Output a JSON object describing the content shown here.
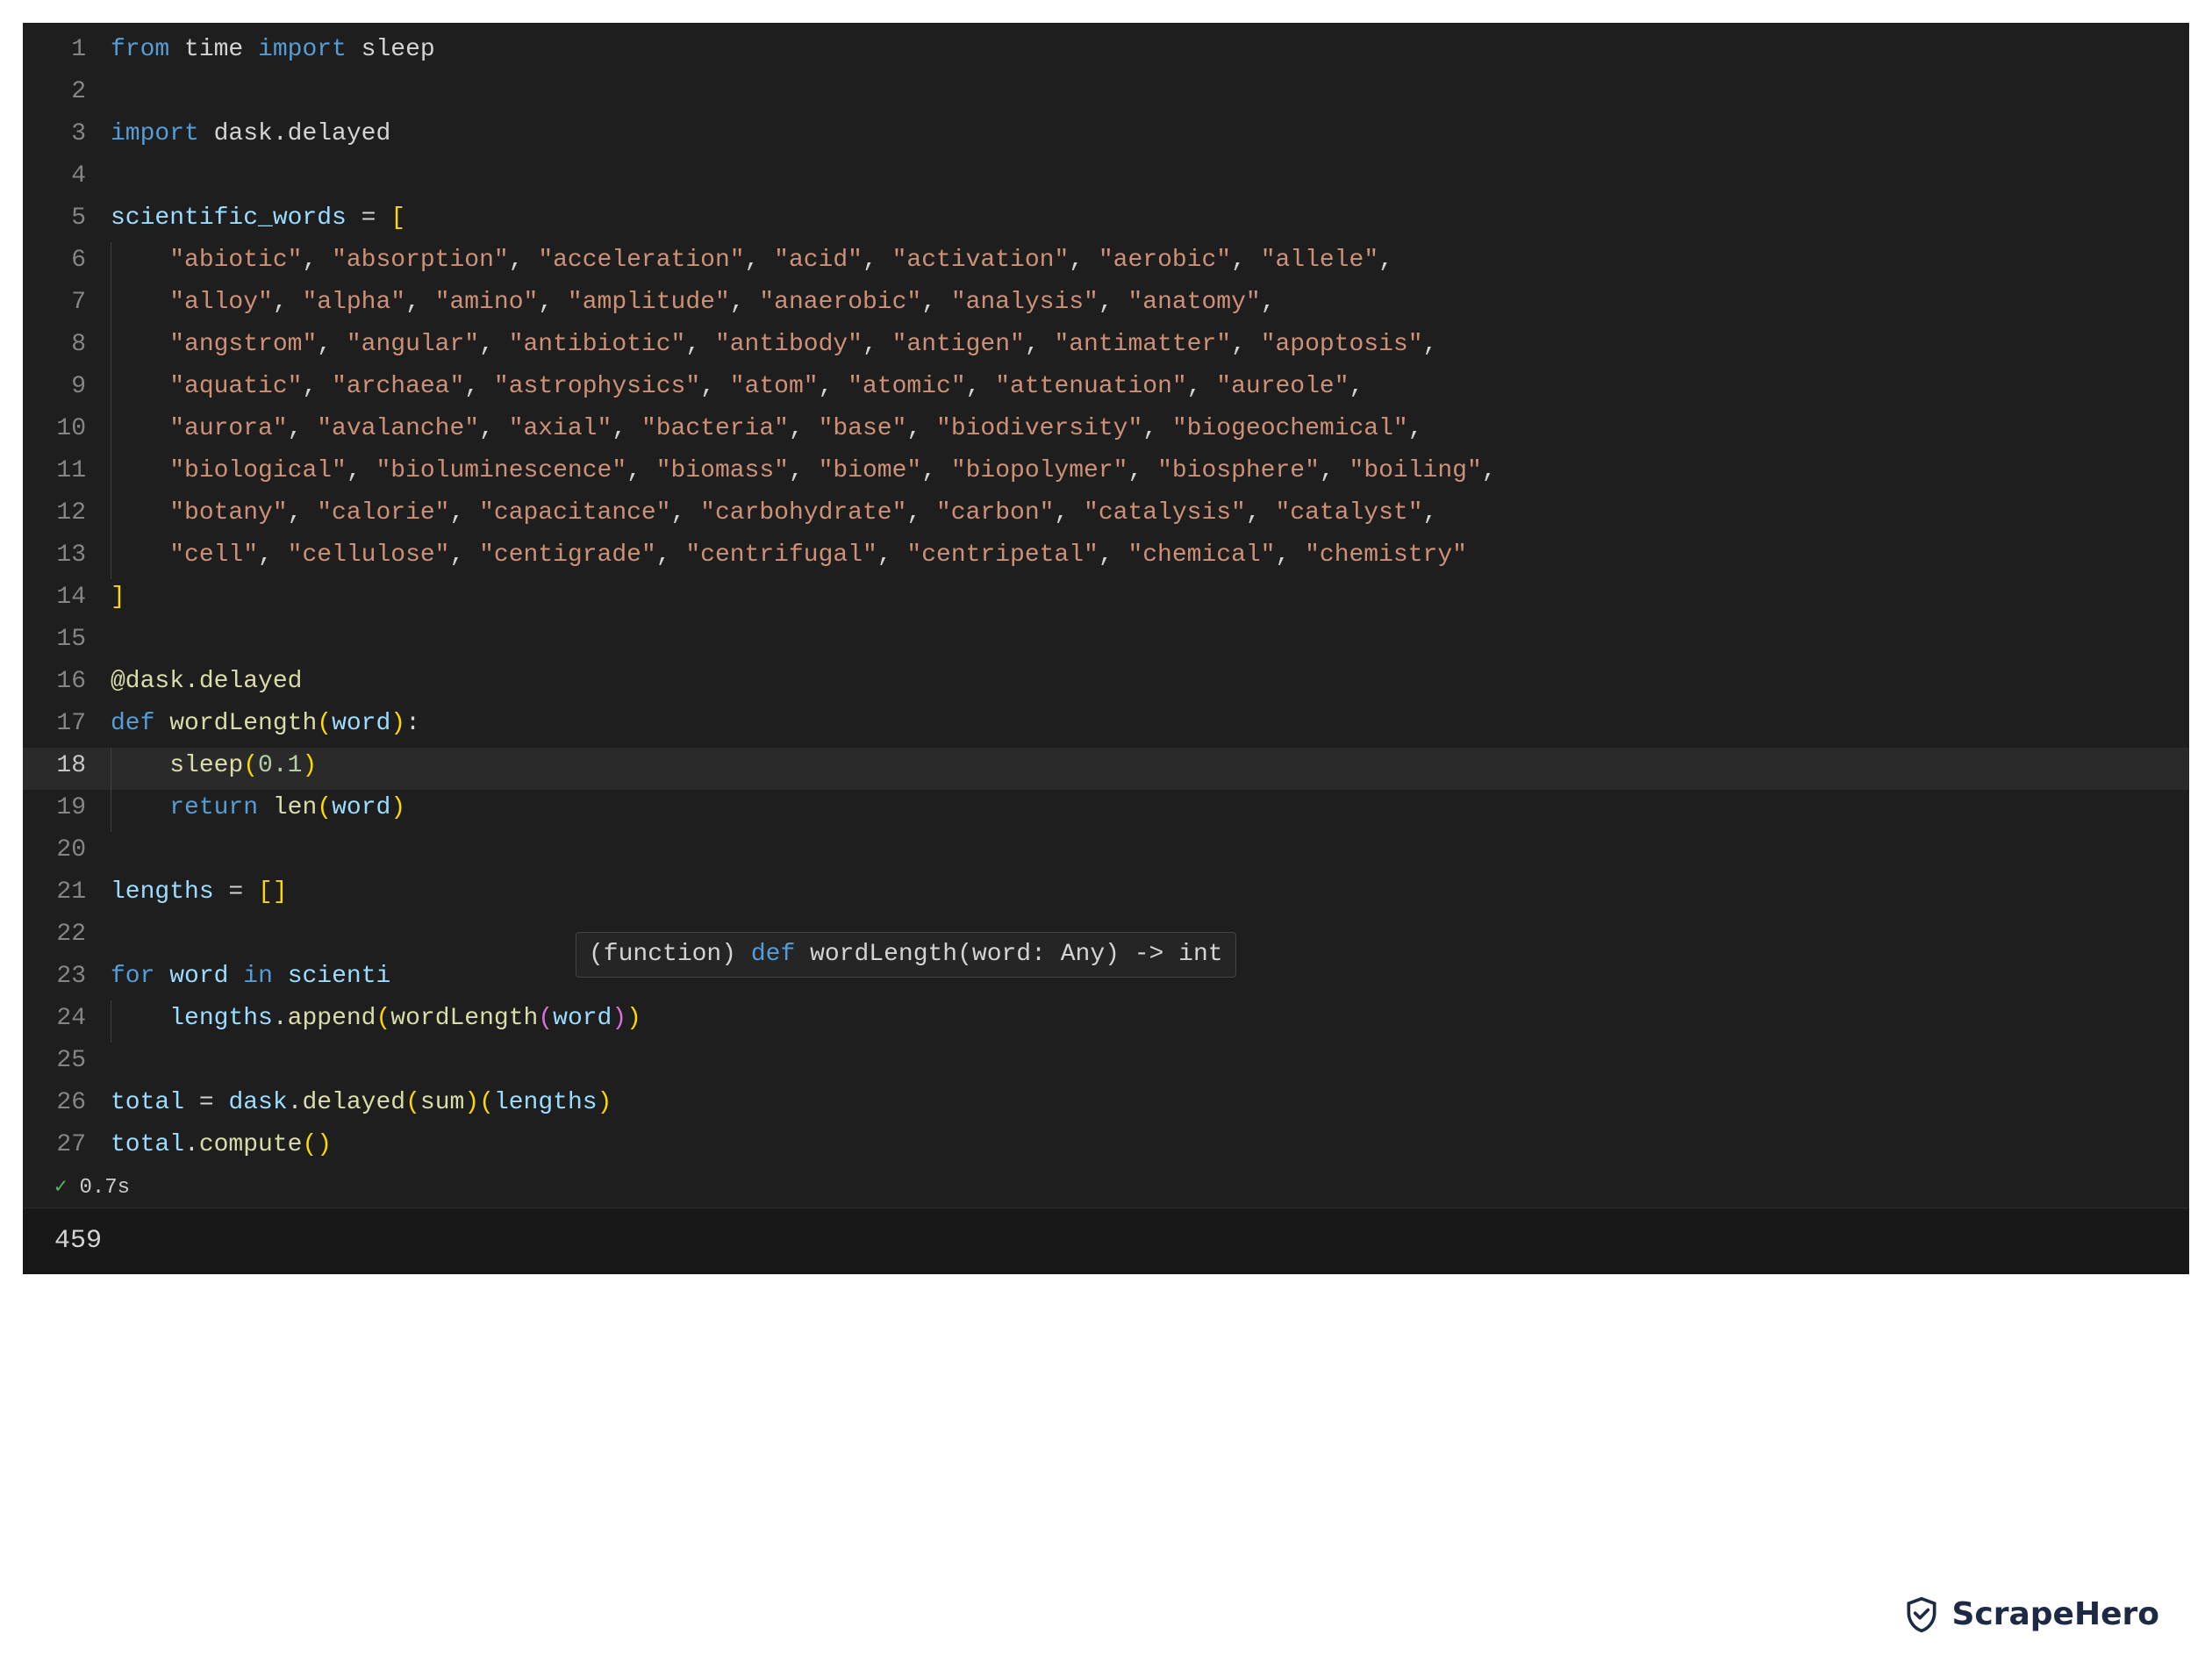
{
  "exec": {
    "status_icon": "✓",
    "duration": "0.7s"
  },
  "output": {
    "value": "459"
  },
  "watermark": {
    "text": "ScrapeHero"
  },
  "hover": {
    "prefix": "(function) ",
    "kw": "def",
    "sig": " wordLength(word: Any) -> int"
  },
  "code": {
    "active_line": 18,
    "lines": [
      {
        "n": 1,
        "guide": false,
        "tokens": [
          {
            "c": "tok-kw",
            "t": "from"
          },
          {
            "c": "tok-default",
            "t": " time "
          },
          {
            "c": "tok-kw",
            "t": "import"
          },
          {
            "c": "tok-default",
            "t": " sleep"
          }
        ]
      },
      {
        "n": 2,
        "guide": false,
        "tokens": []
      },
      {
        "n": 3,
        "guide": false,
        "tokens": [
          {
            "c": "tok-kw",
            "t": "import"
          },
          {
            "c": "tok-default",
            "t": " dask.delayed"
          }
        ]
      },
      {
        "n": 4,
        "guide": false,
        "tokens": []
      },
      {
        "n": 5,
        "guide": false,
        "tokens": [
          {
            "c": "tok-var",
            "t": "scientific_words"
          },
          {
            "c": "tok-default",
            "t": " = "
          },
          {
            "c": "tok-brkt",
            "t": "["
          }
        ]
      },
      {
        "n": 6,
        "guide": true,
        "tokens": [
          {
            "c": "tok-default",
            "t": "    "
          },
          {
            "c": "tok-str",
            "t": "\"abiotic\""
          },
          {
            "c": "tok-default",
            "t": ", "
          },
          {
            "c": "tok-str",
            "t": "\"absorption\""
          },
          {
            "c": "tok-default",
            "t": ", "
          },
          {
            "c": "tok-str",
            "t": "\"acceleration\""
          },
          {
            "c": "tok-default",
            "t": ", "
          },
          {
            "c": "tok-str",
            "t": "\"acid\""
          },
          {
            "c": "tok-default",
            "t": ", "
          },
          {
            "c": "tok-str",
            "t": "\"activation\""
          },
          {
            "c": "tok-default",
            "t": ", "
          },
          {
            "c": "tok-str",
            "t": "\"aerobic\""
          },
          {
            "c": "tok-default",
            "t": ", "
          },
          {
            "c": "tok-str",
            "t": "\"allele\""
          },
          {
            "c": "tok-default",
            "t": ","
          }
        ]
      },
      {
        "n": 7,
        "guide": true,
        "tokens": [
          {
            "c": "tok-default",
            "t": "    "
          },
          {
            "c": "tok-str",
            "t": "\"alloy\""
          },
          {
            "c": "tok-default",
            "t": ", "
          },
          {
            "c": "tok-str",
            "t": "\"alpha\""
          },
          {
            "c": "tok-default",
            "t": ", "
          },
          {
            "c": "tok-str",
            "t": "\"amino\""
          },
          {
            "c": "tok-default",
            "t": ", "
          },
          {
            "c": "tok-str",
            "t": "\"amplitude\""
          },
          {
            "c": "tok-default",
            "t": ", "
          },
          {
            "c": "tok-str",
            "t": "\"anaerobic\""
          },
          {
            "c": "tok-default",
            "t": ", "
          },
          {
            "c": "tok-str",
            "t": "\"analysis\""
          },
          {
            "c": "tok-default",
            "t": ", "
          },
          {
            "c": "tok-str",
            "t": "\"anatomy\""
          },
          {
            "c": "tok-default",
            "t": ","
          }
        ]
      },
      {
        "n": 8,
        "guide": true,
        "tokens": [
          {
            "c": "tok-default",
            "t": "    "
          },
          {
            "c": "tok-str",
            "t": "\"angstrom\""
          },
          {
            "c": "tok-default",
            "t": ", "
          },
          {
            "c": "tok-str",
            "t": "\"angular\""
          },
          {
            "c": "tok-default",
            "t": ", "
          },
          {
            "c": "tok-str",
            "t": "\"antibiotic\""
          },
          {
            "c": "tok-default",
            "t": ", "
          },
          {
            "c": "tok-str",
            "t": "\"antibody\""
          },
          {
            "c": "tok-default",
            "t": ", "
          },
          {
            "c": "tok-str",
            "t": "\"antigen\""
          },
          {
            "c": "tok-default",
            "t": ", "
          },
          {
            "c": "tok-str",
            "t": "\"antimatter\""
          },
          {
            "c": "tok-default",
            "t": ", "
          },
          {
            "c": "tok-str",
            "t": "\"apoptosis\""
          },
          {
            "c": "tok-default",
            "t": ","
          }
        ]
      },
      {
        "n": 9,
        "guide": true,
        "tokens": [
          {
            "c": "tok-default",
            "t": "    "
          },
          {
            "c": "tok-str",
            "t": "\"aquatic\""
          },
          {
            "c": "tok-default",
            "t": ", "
          },
          {
            "c": "tok-str",
            "t": "\"archaea\""
          },
          {
            "c": "tok-default",
            "t": ", "
          },
          {
            "c": "tok-str",
            "t": "\"astrophysics\""
          },
          {
            "c": "tok-default",
            "t": ", "
          },
          {
            "c": "tok-str",
            "t": "\"atom\""
          },
          {
            "c": "tok-default",
            "t": ", "
          },
          {
            "c": "tok-str",
            "t": "\"atomic\""
          },
          {
            "c": "tok-default",
            "t": ", "
          },
          {
            "c": "tok-str",
            "t": "\"attenuation\""
          },
          {
            "c": "tok-default",
            "t": ", "
          },
          {
            "c": "tok-str",
            "t": "\"aureole\""
          },
          {
            "c": "tok-default",
            "t": ","
          }
        ]
      },
      {
        "n": 10,
        "guide": true,
        "tokens": [
          {
            "c": "tok-default",
            "t": "    "
          },
          {
            "c": "tok-str",
            "t": "\"aurora\""
          },
          {
            "c": "tok-default",
            "t": ", "
          },
          {
            "c": "tok-str",
            "t": "\"avalanche\""
          },
          {
            "c": "tok-default",
            "t": ", "
          },
          {
            "c": "tok-str",
            "t": "\"axial\""
          },
          {
            "c": "tok-default",
            "t": ", "
          },
          {
            "c": "tok-str",
            "t": "\"bacteria\""
          },
          {
            "c": "tok-default",
            "t": ", "
          },
          {
            "c": "tok-str",
            "t": "\"base\""
          },
          {
            "c": "tok-default",
            "t": ", "
          },
          {
            "c": "tok-str",
            "t": "\"biodiversity\""
          },
          {
            "c": "tok-default",
            "t": ", "
          },
          {
            "c": "tok-str",
            "t": "\"biogeochemical\""
          },
          {
            "c": "tok-default",
            "t": ","
          }
        ]
      },
      {
        "n": 11,
        "guide": true,
        "tokens": [
          {
            "c": "tok-default",
            "t": "    "
          },
          {
            "c": "tok-str",
            "t": "\"biological\""
          },
          {
            "c": "tok-default",
            "t": ", "
          },
          {
            "c": "tok-str",
            "t": "\"bioluminescence\""
          },
          {
            "c": "tok-default",
            "t": ", "
          },
          {
            "c": "tok-str",
            "t": "\"biomass\""
          },
          {
            "c": "tok-default",
            "t": ", "
          },
          {
            "c": "tok-str",
            "t": "\"biome\""
          },
          {
            "c": "tok-default",
            "t": ", "
          },
          {
            "c": "tok-str",
            "t": "\"biopolymer\""
          },
          {
            "c": "tok-default",
            "t": ", "
          },
          {
            "c": "tok-str",
            "t": "\"biosphere\""
          },
          {
            "c": "tok-default",
            "t": ", "
          },
          {
            "c": "tok-str",
            "t": "\"boiling\""
          },
          {
            "c": "tok-default",
            "t": ","
          }
        ]
      },
      {
        "n": 12,
        "guide": true,
        "tokens": [
          {
            "c": "tok-default",
            "t": "    "
          },
          {
            "c": "tok-str",
            "t": "\"botany\""
          },
          {
            "c": "tok-default",
            "t": ", "
          },
          {
            "c": "tok-str",
            "t": "\"calorie\""
          },
          {
            "c": "tok-default",
            "t": ", "
          },
          {
            "c": "tok-str",
            "t": "\"capacitance\""
          },
          {
            "c": "tok-default",
            "t": ", "
          },
          {
            "c": "tok-str",
            "t": "\"carbohydrate\""
          },
          {
            "c": "tok-default",
            "t": ", "
          },
          {
            "c": "tok-str",
            "t": "\"carbon\""
          },
          {
            "c": "tok-default",
            "t": ", "
          },
          {
            "c": "tok-str",
            "t": "\"catalysis\""
          },
          {
            "c": "tok-default",
            "t": ", "
          },
          {
            "c": "tok-str",
            "t": "\"catalyst\""
          },
          {
            "c": "tok-default",
            "t": ","
          }
        ]
      },
      {
        "n": 13,
        "guide": true,
        "tokens": [
          {
            "c": "tok-default",
            "t": "    "
          },
          {
            "c": "tok-str",
            "t": "\"cell\""
          },
          {
            "c": "tok-default",
            "t": ", "
          },
          {
            "c": "tok-str",
            "t": "\"cellulose\""
          },
          {
            "c": "tok-default",
            "t": ", "
          },
          {
            "c": "tok-str",
            "t": "\"centigrade\""
          },
          {
            "c": "tok-default",
            "t": ", "
          },
          {
            "c": "tok-str",
            "t": "\"centrifugal\""
          },
          {
            "c": "tok-default",
            "t": ", "
          },
          {
            "c": "tok-str",
            "t": "\"centripetal\""
          },
          {
            "c": "tok-default",
            "t": ", "
          },
          {
            "c": "tok-str",
            "t": "\"chemical\""
          },
          {
            "c": "tok-default",
            "t": ", "
          },
          {
            "c": "tok-str",
            "t": "\"chemistry\""
          }
        ]
      },
      {
        "n": 14,
        "guide": false,
        "tokens": [
          {
            "c": "tok-brkt",
            "t": "]"
          }
        ]
      },
      {
        "n": 15,
        "guide": false,
        "tokens": []
      },
      {
        "n": 16,
        "guide": false,
        "tokens": [
          {
            "c": "tok-deco",
            "t": "@dask.delayed"
          }
        ]
      },
      {
        "n": 17,
        "guide": false,
        "tokens": [
          {
            "c": "tok-kw",
            "t": "def"
          },
          {
            "c": "tok-default",
            "t": " "
          },
          {
            "c": "tok-fn",
            "t": "wordLength"
          },
          {
            "c": "tok-brkt",
            "t": "("
          },
          {
            "c": "tok-var",
            "t": "word"
          },
          {
            "c": "tok-brkt",
            "t": ")"
          },
          {
            "c": "tok-default",
            "t": ":"
          }
        ]
      },
      {
        "n": 18,
        "guide": true,
        "tokens": [
          {
            "c": "tok-default",
            "t": "    "
          },
          {
            "c": "tok-fn",
            "t": "sleep"
          },
          {
            "c": "tok-brkt",
            "t": "("
          },
          {
            "c": "tok-num",
            "t": "0.1"
          },
          {
            "c": "tok-brkt",
            "t": ")"
          }
        ]
      },
      {
        "n": 19,
        "guide": true,
        "tokens": [
          {
            "c": "tok-default",
            "t": "    "
          },
          {
            "c": "tok-kw",
            "t": "return"
          },
          {
            "c": "tok-default",
            "t": " "
          },
          {
            "c": "tok-builtin",
            "t": "len"
          },
          {
            "c": "tok-brkt",
            "t": "("
          },
          {
            "c": "tok-var",
            "t": "word"
          },
          {
            "c": "tok-brkt",
            "t": ")"
          }
        ]
      },
      {
        "n": 20,
        "guide": false,
        "tokens": []
      },
      {
        "n": 21,
        "guide": false,
        "tokens": [
          {
            "c": "tok-var",
            "t": "lengths"
          },
          {
            "c": "tok-default",
            "t": " = "
          },
          {
            "c": "tok-brkt",
            "t": "[]"
          }
        ]
      },
      {
        "n": 22,
        "guide": false,
        "tokens": []
      },
      {
        "n": 23,
        "guide": false,
        "tokens": [
          {
            "c": "tok-kw",
            "t": "for"
          },
          {
            "c": "tok-default",
            "t": " "
          },
          {
            "c": "tok-var",
            "t": "word"
          },
          {
            "c": "tok-default",
            "t": " "
          },
          {
            "c": "tok-kw",
            "t": "in"
          },
          {
            "c": "tok-default",
            "t": " "
          },
          {
            "c": "tok-var",
            "t": "scienti"
          }
        ]
      },
      {
        "n": 24,
        "guide": true,
        "tokens": [
          {
            "c": "tok-default",
            "t": "    "
          },
          {
            "c": "tok-var",
            "t": "lengths"
          },
          {
            "c": "tok-default",
            "t": "."
          },
          {
            "c": "tok-fn",
            "t": "append"
          },
          {
            "c": "tok-brkt",
            "t": "("
          },
          {
            "c": "tok-fn",
            "t": "wordLength"
          },
          {
            "c": "tok-brkt2",
            "t": "("
          },
          {
            "c": "tok-var",
            "t": "word"
          },
          {
            "c": "tok-brkt2",
            "t": ")"
          },
          {
            "c": "tok-brkt",
            "t": ")"
          }
        ]
      },
      {
        "n": 25,
        "guide": false,
        "tokens": []
      },
      {
        "n": 26,
        "guide": false,
        "tokens": [
          {
            "c": "tok-var",
            "t": "total"
          },
          {
            "c": "tok-default",
            "t": " = "
          },
          {
            "c": "tok-var",
            "t": "dask"
          },
          {
            "c": "tok-default",
            "t": "."
          },
          {
            "c": "tok-fn",
            "t": "delayed"
          },
          {
            "c": "tok-brkt",
            "t": "("
          },
          {
            "c": "tok-builtin",
            "t": "sum"
          },
          {
            "c": "tok-brkt",
            "t": ")"
          },
          {
            "c": "tok-brkt",
            "t": "("
          },
          {
            "c": "tok-var",
            "t": "lengths"
          },
          {
            "c": "tok-brkt",
            "t": ")"
          }
        ]
      },
      {
        "n": 27,
        "guide": false,
        "tokens": [
          {
            "c": "tok-var",
            "t": "total"
          },
          {
            "c": "tok-default",
            "t": "."
          },
          {
            "c": "tok-fn",
            "t": "compute"
          },
          {
            "c": "tok-brkt",
            "t": "()"
          }
        ]
      }
    ]
  }
}
